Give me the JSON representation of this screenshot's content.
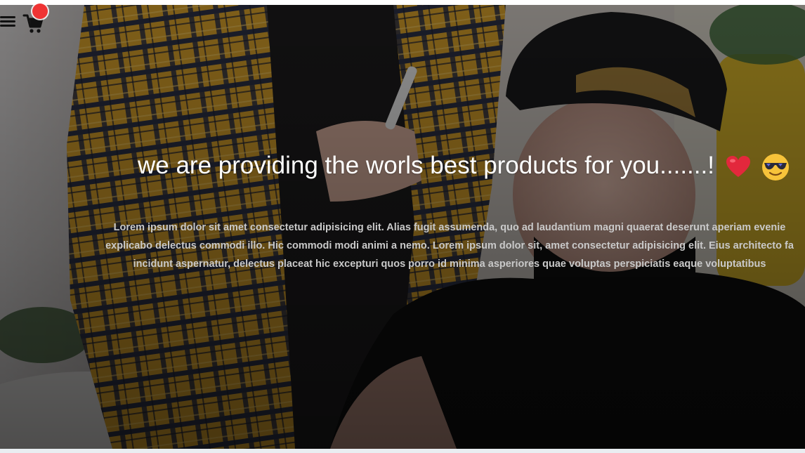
{
  "hero": {
    "image_description": "",
    "headline": "we are providing the worls best products for you.......!",
    "headline_emojis": [
      "red-heart",
      "smiling-face-with-sunglasses"
    ],
    "paragraph_lines": [
      "Lorem ipsum dolor sit amet consectetur adipisicing elit. Alias fugit assumenda, quo ad laudantium magni quaerat deserunt aperiam evenie",
      "explicabo delectus commodi illo. Hic commodi modi animi a nemo. Lorem ipsum dolor sit, amet consectetur adipisicing elit. Eius architecto fa",
      "incidunt aspernatur, delectus placeat hic excepturi quos porro id minima asperiores quae voluptas perspiciatis eaque voluptatibus"
    ]
  },
  "navbar": {
    "menu_icon": "hamburger-menu-icon",
    "cart_icon": "shopping-cart-icon",
    "cart_badge_color": "#ef3434"
  },
  "colors": {
    "headline": "#ffffff",
    "paragraph": "#c9c9c9",
    "overlay": "#000000"
  }
}
